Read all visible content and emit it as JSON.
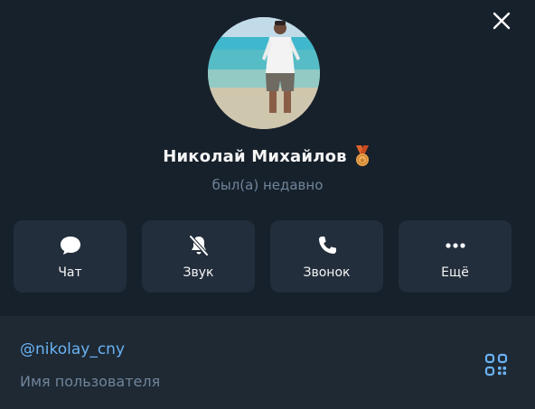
{
  "window": {
    "close_icon": "close-icon"
  },
  "profile": {
    "name": "Николай Михайлов",
    "badge_icon": "medal-icon",
    "status": "был(а) недавно"
  },
  "actions": [
    {
      "label": "Чат",
      "icon": "chat-bubble-icon"
    },
    {
      "label": "Звук",
      "icon": "bell-muted-icon"
    },
    {
      "label": "Звонок",
      "icon": "phone-icon"
    },
    {
      "label": "Ещё",
      "icon": "more-dots-icon"
    }
  ],
  "info": {
    "username": "@nikolay_cny",
    "username_caption": "Имя пользователя",
    "qr_icon": "qr-code-icon"
  },
  "colors": {
    "background": "#17212b",
    "action_bg": "#232e3c",
    "info_bg": "#1e2934",
    "accent_link": "#6ab2f2",
    "secondary_text": "#708499",
    "primary_text": "#f5f5f5"
  }
}
